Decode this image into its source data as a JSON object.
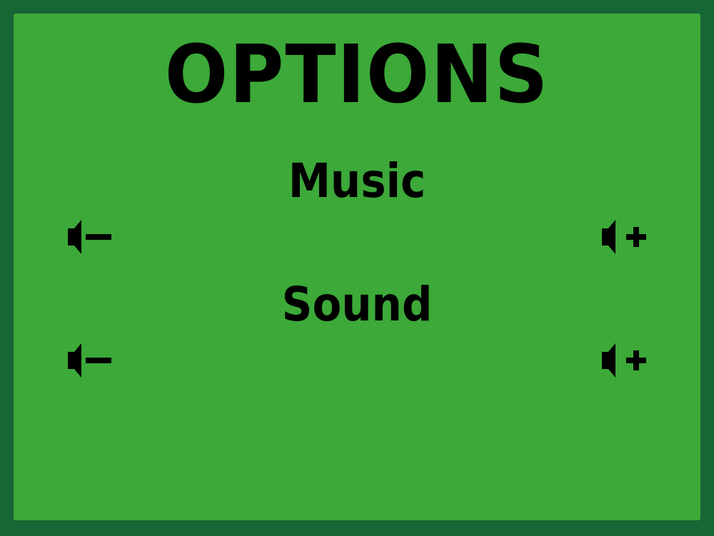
{
  "screen": {
    "title": "OPTIONS",
    "background_color": "#3ca939",
    "border_color": "#176635"
  },
  "music": {
    "label": "Music",
    "volume_down_icon": "speaker-minus-icon",
    "volume_up_icon": "speaker-plus-icon"
  },
  "sound": {
    "label": "Sound",
    "volume_down_icon": "speaker-minus-icon",
    "volume_up_icon": "speaker-plus-icon"
  }
}
